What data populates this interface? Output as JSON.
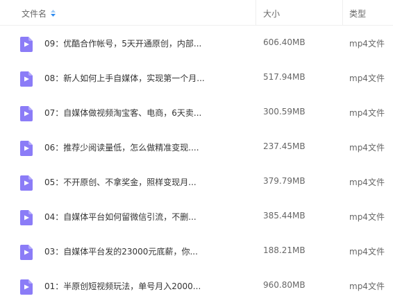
{
  "header": {
    "name_label": "文件名",
    "size_label": "大小",
    "type_label": "类型",
    "sort_icon": "sort-arrows-icon"
  },
  "colors": {
    "icon_purple": "#8b7cf7",
    "sort_blue": "#2e8bf0"
  },
  "files": [
    {
      "name": "09：优酷合作帐号，5天开通原创，内部...",
      "size": "606.40MB",
      "type": "mp4文件",
      "icon": "video-file-icon"
    },
    {
      "name": "08：新人如何上手自媒体，实现第一个月...",
      "size": "517.94MB",
      "type": "mp4文件",
      "icon": "video-file-icon"
    },
    {
      "name": "07：自媒体做视频淘宝客、电商，6天卖...",
      "size": "300.59MB",
      "type": "mp4文件",
      "icon": "video-file-icon"
    },
    {
      "name": "06：推荐少阅读量低，怎么做精准变现....",
      "size": "237.45MB",
      "type": "mp4文件",
      "icon": "video-file-icon"
    },
    {
      "name": "05：不开原创、不拿奖金，照样变现月...",
      "size": "379.79MB",
      "type": "mp4文件",
      "icon": "video-file-icon"
    },
    {
      "name": "04：自媒体平台如何留微信引流，不删...",
      "size": "385.44MB",
      "type": "mp4文件",
      "icon": "video-file-icon"
    },
    {
      "name": "03：自媒体平台发的23000元底薪，你...",
      "size": "188.21MB",
      "type": "mp4文件",
      "icon": "video-file-icon"
    },
    {
      "name": "01：半原创短视频玩法，单号月入2000...",
      "size": "960.80MB",
      "type": "mp4文件",
      "icon": "video-file-icon"
    }
  ]
}
